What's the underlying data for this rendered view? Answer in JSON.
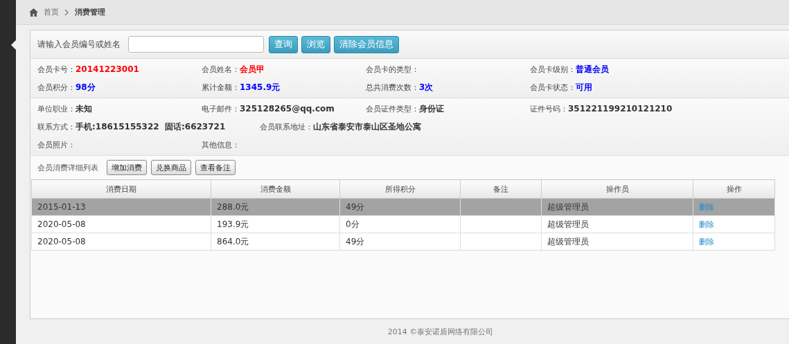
{
  "breadcrumb": {
    "home": "首页",
    "current": "消费管理"
  },
  "search": {
    "label": "请输入会员编号或姓名",
    "buttons": [
      "查询",
      "浏览",
      "清除会员信息"
    ]
  },
  "info_sections": [
    {
      "rows": [
        {
          "fields": [
            {
              "label": "会员卡号：",
              "value": "20141223001",
              "color": "#ff0000"
            },
            {
              "label": "会员姓名：",
              "value": "会员甲",
              "color": "#ff0000"
            },
            {
              "label": "会员卡的类型："
            },
            {
              "label": "会员卡级别：",
              "value": "普通会员",
              "color": "#0000ff"
            }
          ]
        },
        {
          "fields": [
            {
              "label": "会员积分：",
              "value": "98分",
              "color": "#0000ff"
            },
            {
              "label": "累计金额：",
              "value": "1345.9元",
              "color": "#0000ff"
            },
            {
              "label": "总共消费次数：",
              "value": "3次",
              "color": "#0000ff"
            },
            {
              "label": "会员卡状态：",
              "value": "可用",
              "color": "#0000ff"
            }
          ]
        }
      ]
    },
    {
      "rows": [
        {
          "fields": [
            {
              "label": "单位职业：",
              "value": "未知",
              "color": "#333333"
            },
            {
              "label": "电子邮件：",
              "value": "325128265@qq.com",
              "color": "#333333"
            },
            {
              "label": "会员证件类型：",
              "value": "身份证",
              "color": "#333333"
            },
            {
              "label": "证件号码：",
              "value": "351221199210121210",
              "color": "#333333"
            }
          ]
        },
        {
          "fields": [
            {
              "label": "联系方式：",
              "value": "手机:18615155322  固话:6623721",
              "color": "#333333"
            },
            {
              "label": "会员联系地址：",
              "value": "山东省泰安市泰山区圣地公寓",
              "color": "#333333"
            }
          ]
        },
        {
          "fields": [
            {
              "label": "会员照片："
            },
            {
              "label": "其他信息："
            }
          ]
        }
      ]
    }
  ],
  "list_toolbar": {
    "title": "会员消费详细列表",
    "buttons": [
      "增加消费",
      "兑换商品",
      "查看备注"
    ]
  },
  "table": {
    "columns": [
      "消费日期",
      "消费金额",
      "所得积分",
      "备注",
      "操作员",
      "操作"
    ],
    "rows": [
      {
        "selected": true,
        "cells": [
          "2015-01-13",
          "288.0元",
          "49分",
          "",
          "超级管理员"
        ],
        "action": "删除"
      },
      {
        "selected": false,
        "cells": [
          "2020-05-08",
          "193.9元",
          "0分",
          "",
          "超级管理员"
        ],
        "action": "删除"
      },
      {
        "selected": false,
        "cells": [
          "2020-05-08",
          "864.0元",
          "49分",
          "",
          "超级管理员"
        ],
        "action": "删除"
      }
    ]
  },
  "footer": "2014 ©泰安诺盾网络有限公司"
}
